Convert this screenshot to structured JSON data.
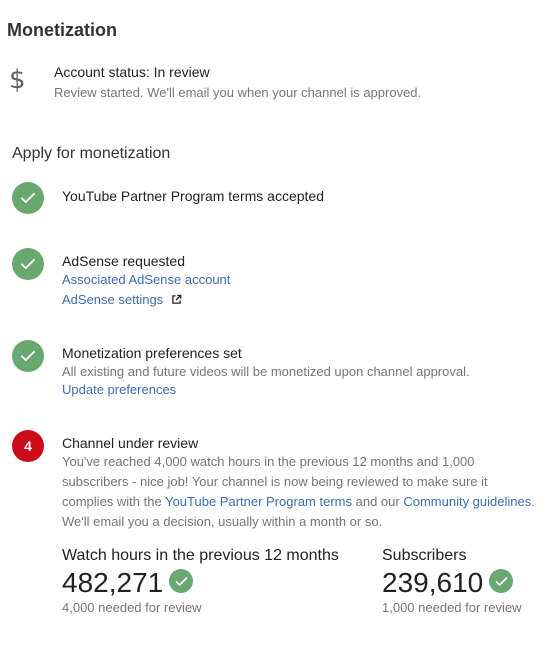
{
  "page_title": "Monetization",
  "account_status": {
    "icon": "dollar-icon",
    "title": "Account status: In review",
    "description": "Review started. We'll email you when your channel is approved."
  },
  "apply_section": {
    "title": "Apply for monetization",
    "steps": [
      {
        "state": "done",
        "title": "YouTube Partner Program terms accepted"
      },
      {
        "state": "done",
        "title": "AdSense requested",
        "links": [
          "Associated AdSense account",
          "AdSense settings"
        ]
      },
      {
        "state": "done",
        "title": "Monetization preferences set",
        "description": "All existing and future videos will be monetized upon channel approval.",
        "link": "Update preferences"
      },
      {
        "state": "current",
        "number": "4",
        "title": "Channel under review",
        "desc_part1": "You've reached 4,000 watch hours in the previous 12 months and 1,000 subscribers - nice job! Your channel is now being reviewed to make sure it complies with the ",
        "desc_link1": "YouTube Partner Program terms",
        "desc_part2": " and our ",
        "desc_link2": "Community guidelines",
        "desc_part3": ". We'll email you a decision, usually within a month or so."
      }
    ]
  },
  "metrics": [
    {
      "label": "Watch hours in the previous 12 months",
      "value": "482,271",
      "requirement": "4,000 needed for review"
    },
    {
      "label": "Subscribers",
      "value": "239,610",
      "requirement": "1,000 needed for review"
    }
  ],
  "colors": {
    "check_green": "#6aa872",
    "current_red": "#cc0b1a",
    "link_blue": "#3d6ea8"
  }
}
